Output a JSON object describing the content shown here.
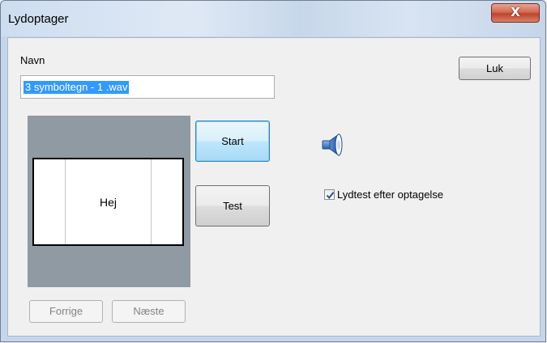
{
  "window": {
    "title": "Lydoptager",
    "close_glyph": "X"
  },
  "form": {
    "name_label": "Navn",
    "name_value": "3 symboltegn - 1 .wav"
  },
  "buttons": {
    "close_label": "Luk",
    "start_label": "Start",
    "test_label": "Test",
    "prev_label": "Forrige",
    "next_label": "Næste"
  },
  "preview": {
    "card_text": "Hej"
  },
  "options": {
    "sound_test_label": "Lydtest efter optagelse",
    "sound_test_checked": true
  },
  "icons": {
    "speaker": "speaker-icon",
    "close": "close-icon",
    "check": "check-icon"
  },
  "colors": {
    "selection": "#3399ff",
    "preview_panel": "#909aa3",
    "start_border": "#3c7fb1",
    "close_button": "#c0432c"
  }
}
